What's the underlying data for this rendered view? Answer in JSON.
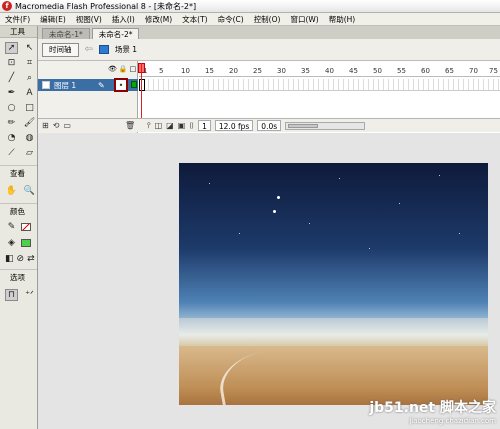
{
  "window": {
    "logo": "f",
    "title": "Macromedia Flash Professional 8 - [未命名-2*]"
  },
  "menu": [
    "文件(F)",
    "编辑(E)",
    "视图(V)",
    "插入(I)",
    "修改(M)",
    "文本(T)",
    "命令(C)",
    "控制(O)",
    "窗口(W)",
    "帮助(H)"
  ],
  "tools": {
    "header": "工具",
    "sections": {
      "view": "查看",
      "colors": "颜色",
      "options": "选项"
    }
  },
  "tabs": [
    "未命名-1*",
    "未命名-2*"
  ],
  "editbar": {
    "timeline_button": "时间轴",
    "scene_label": "场景 1"
  },
  "timeline": {
    "layer_name": "图层 1",
    "ruler": [
      "1",
      "5",
      "10",
      "15",
      "20",
      "25",
      "30",
      "35",
      "40",
      "45",
      "50",
      "55",
      "60",
      "65",
      "70",
      "75"
    ],
    "current_frame": "1",
    "frame_rate": "12.0 fps",
    "elapsed_time": "0.0s"
  },
  "watermark": {
    "line1": "jb51.net 脚本之家",
    "line2": "jiaocheng.chazidian.com"
  },
  "colors": {
    "layer_highlight": "#3a6ea5",
    "playhead": "#e02020",
    "annotation_box": "#8b0000"
  }
}
